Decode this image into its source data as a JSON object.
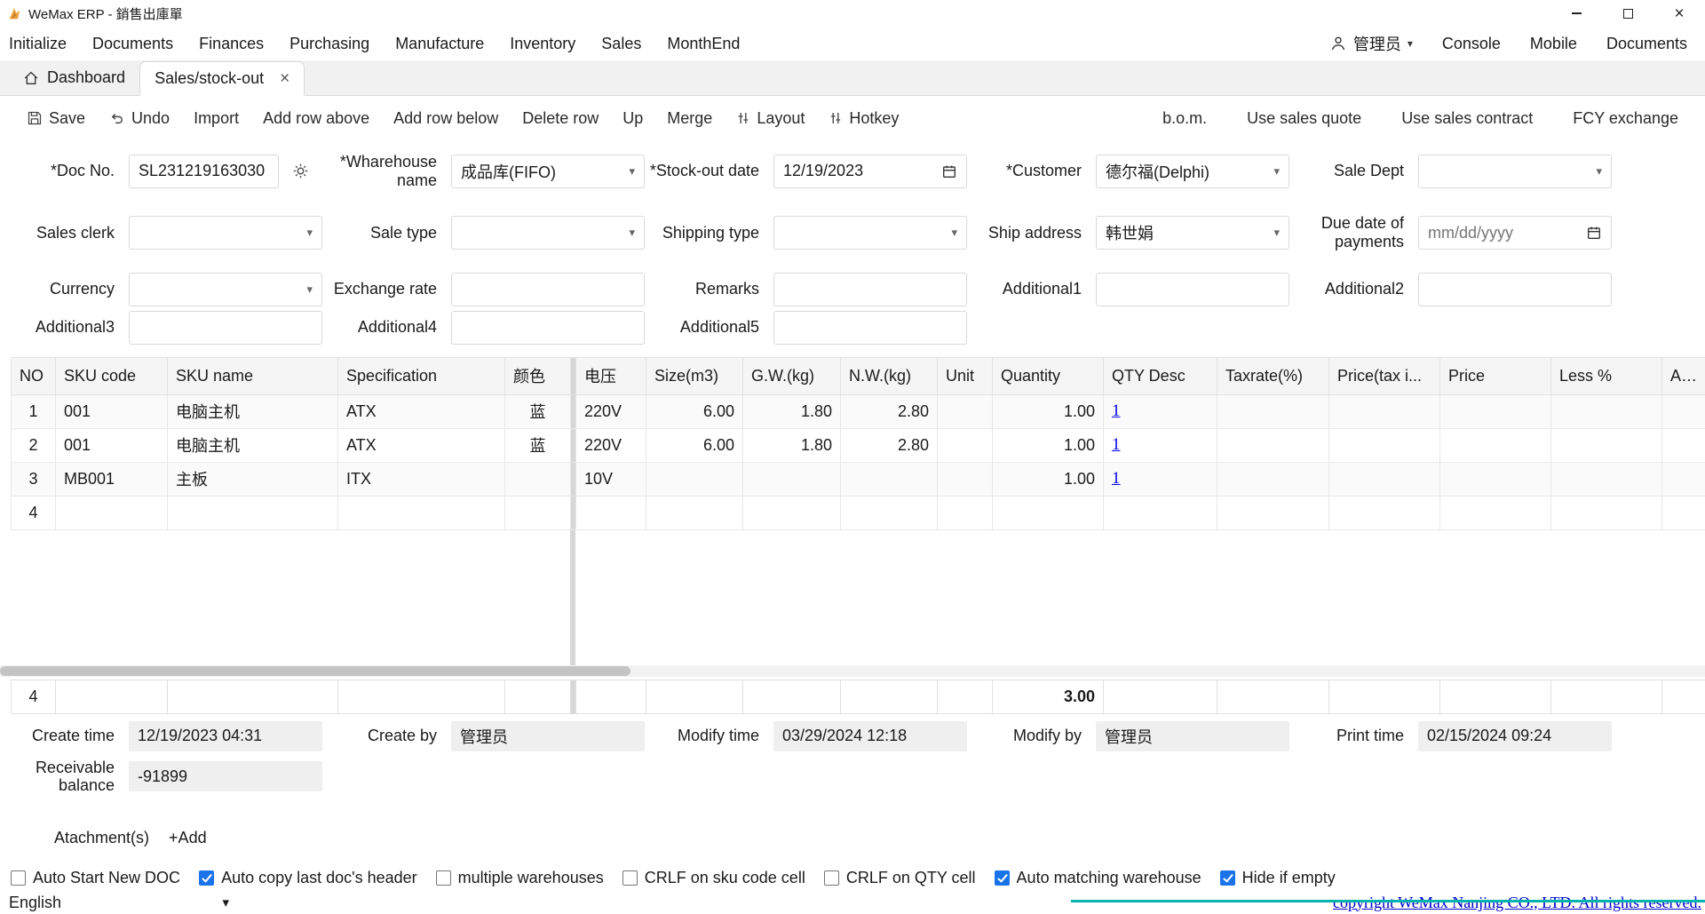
{
  "window": {
    "title": "WeMax ERP - 銷售出庫單"
  },
  "menubar": {
    "items": [
      "Initialize",
      "Documents",
      "Finances",
      "Purchasing",
      "Manufacture",
      "Inventory",
      "Sales",
      "MonthEnd"
    ],
    "user": "管理员",
    "console": "Console",
    "mobile": "Mobile",
    "documents": "Documents"
  },
  "tabs": {
    "dashboard": "Dashboard",
    "active": "Sales/stock-out"
  },
  "toolbar": {
    "save": "Save",
    "undo": "Undo",
    "import": "Import",
    "add_row_above": "Add row above",
    "add_row_below": "Add row below",
    "delete_row": "Delete row",
    "up": "Up",
    "merge": "Merge",
    "layout": "Layout",
    "hotkey": "Hotkey",
    "bom": "b.o.m.",
    "use_sales_quote": "Use sales quote",
    "use_sales_contract": "Use sales contract",
    "fcy_exchange": "FCY exchange"
  },
  "form": {
    "doc_no_label": "*Doc No.",
    "doc_no_value": "SL231219163030",
    "warehouse_label": "*Wharehouse name",
    "warehouse_value": "成品库(FIFO)",
    "stock_out_date_label": "*Stock-out date",
    "stock_out_date_value": "12/19/2023",
    "customer_label": "*Customer",
    "customer_value": "德尔福(Delphi)",
    "sale_dept_label": "Sale Dept",
    "sales_clerk_label": "Sales clerk",
    "sale_type_label": "Sale type",
    "shipping_type_label": "Shipping type",
    "ship_address_label": "Ship address",
    "ship_address_value": "韩世娟",
    "due_date_label": "Due date of payments",
    "due_date_placeholder": "mm/dd/yyyy",
    "currency_label": "Currency",
    "exchange_rate_label": "Exchange rate",
    "remarks_label": "Remarks",
    "additional1_label": "Additional1",
    "additional2_label": "Additional2",
    "additional3_label": "Additional3",
    "additional4_label": "Additional4",
    "additional5_label": "Additional5"
  },
  "grid": {
    "columns": [
      "NO",
      "SKU code",
      "SKU name",
      "Specification",
      "颜色",
      "电压",
      "Size(m3)",
      "G.W.(kg)",
      "N.W.(kg)",
      "Unit",
      "Quantity",
      "QTY Desc",
      "Taxrate(%)",
      "Price(tax i...",
      "Price",
      "Less %",
      "Addt..."
    ],
    "rows": [
      [
        "1",
        "001",
        "电脑主机",
        "ATX",
        "蓝",
        "220V",
        "6.00",
        "1.80",
        "2.80",
        "",
        "1.00",
        "1",
        "",
        "",
        "",
        "",
        ""
      ],
      [
        "2",
        "001",
        "电脑主机",
        "ATX",
        "蓝",
        "220V",
        "6.00",
        "1.80",
        "2.80",
        "",
        "1.00",
        "1",
        "",
        "",
        "",
        "",
        ""
      ],
      [
        "3",
        "MB001",
        "主板",
        "ITX",
        "",
        "10V",
        "",
        "",
        "",
        "",
        "1.00",
        "1",
        "",
        "",
        "",
        "",
        ""
      ],
      [
        "4",
        "",
        "",
        "",
        "",
        "",
        "",
        "",
        "",
        "",
        "",
        "",
        "",
        "",
        "",
        "",
        ""
      ]
    ],
    "summary_no": "4",
    "summary_qty": "3.00"
  },
  "footer": {
    "create_time_label": "Create time",
    "create_time_value": "12/19/2023 04:31",
    "create_by_label": "Create by",
    "create_by_value": "管理员",
    "modify_time_label": "Modify time",
    "modify_time_value": "03/29/2024 12:18",
    "modify_by_label": "Modify by",
    "modify_by_value": "管理员",
    "print_time_label": "Print time",
    "print_time_value": "02/15/2024 09:24",
    "receivable_label": "Receivable balance",
    "receivable_value": "-91899",
    "attachments_label": "Atachment(s)",
    "attachments_add": "+Add"
  },
  "options": [
    {
      "label": "Auto Start New DOC",
      "checked": false
    },
    {
      "label": "Auto copy last doc's header",
      "checked": true
    },
    {
      "label": "multiple warehouses",
      "checked": false
    },
    {
      "label": "CRLF on sku code cell",
      "checked": false
    },
    {
      "label": "CRLF on QTY cell",
      "checked": false
    },
    {
      "label": "Auto matching warehouse",
      "checked": true
    },
    {
      "label": "Hide if empty",
      "checked": true
    }
  ],
  "statusbar": {
    "language": "English",
    "copyright": "copyright WeMax Nanjing CO., LTD. All rights reserved."
  }
}
